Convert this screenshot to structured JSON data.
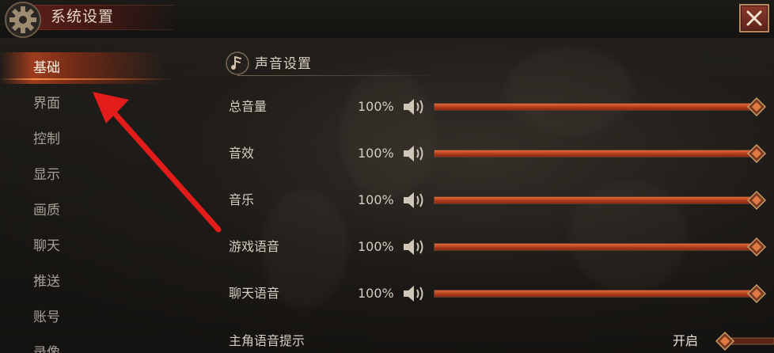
{
  "window": {
    "title": "系统设置",
    "close_label": "✕"
  },
  "sidebar": {
    "items": [
      {
        "label": "基础",
        "active": true
      },
      {
        "label": "界面",
        "active": false
      },
      {
        "label": "控制",
        "active": false
      },
      {
        "label": "显示",
        "active": false
      },
      {
        "label": "画质",
        "active": false
      },
      {
        "label": "聊天",
        "active": false
      },
      {
        "label": "推送",
        "active": false
      },
      {
        "label": "账号",
        "active": false
      },
      {
        "label": "录像",
        "active": false
      }
    ]
  },
  "sound_section": {
    "title": "声音设置",
    "rows": [
      {
        "label": "总音量",
        "value": "100%",
        "level": 1.0
      },
      {
        "label": "音效",
        "value": "100%",
        "level": 1.0
      },
      {
        "label": "音乐",
        "value": "100%",
        "level": 1.0
      },
      {
        "label": "游戏语音",
        "value": "100%",
        "level": 1.0
      },
      {
        "label": "聊天语音",
        "value": "100%",
        "level": 1.0
      }
    ],
    "toggle": {
      "label": "主角语音提示",
      "state": "开启"
    }
  },
  "colors": {
    "accent": "#c8481f",
    "gold": "#b9875a",
    "text": "#d4ccc0"
  },
  "icons": {
    "title": "gear-icon",
    "close": "close-icon",
    "section": "music-note-icon",
    "volume": "speaker-icon"
  }
}
